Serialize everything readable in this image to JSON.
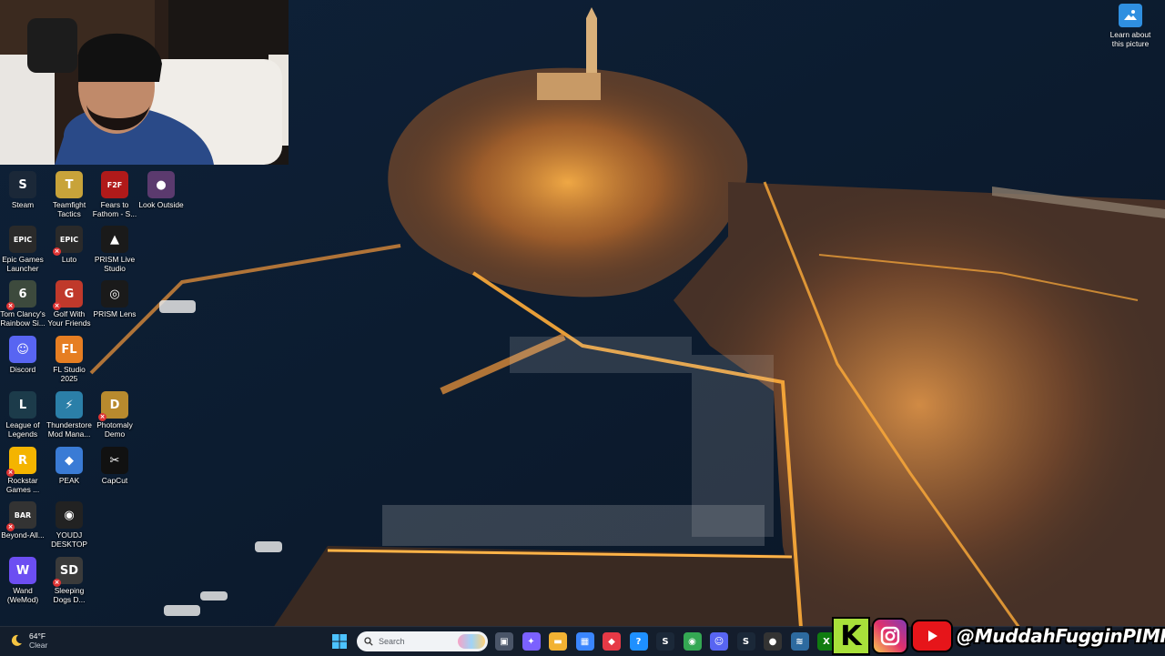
{
  "desktop": {
    "icons": [
      {
        "label": "Steam",
        "color": "#1b2838",
        "glyph": "S",
        "icon": "steam-icon"
      },
      {
        "label": "Teamfight Tactics",
        "color": "#c8a33a",
        "glyph": "T",
        "icon": "teamfight-tactics-icon"
      },
      {
        "label": "Fears to Fathom - S...",
        "color": "#b01a1a",
        "glyph": "F2F",
        "icon": "fears-to-fathom-icon"
      },
      {
        "label": "Look Outside",
        "color": "#5b3a6e",
        "glyph": "●",
        "icon": "look-outside-icon"
      },
      {
        "label": "Epic Games Launcher",
        "color": "#2a2a2a",
        "glyph": "EPIC",
        "icon": "epic-games-icon"
      },
      {
        "label": "Luto",
        "color": "#2a2a2a",
        "glyph": "EPIC",
        "icon": "luto-icon"
      },
      {
        "label": "PRISM Live Studio",
        "color": "#1a1a1a",
        "glyph": "▲",
        "icon": "prism-live-icon"
      },
      {
        "label": "Tom Clancy's Rainbow Si...",
        "color": "#3d4a3d",
        "glyph": "6",
        "icon": "rainbow-six-icon"
      },
      {
        "label": "Golf With Your Friends",
        "color": "#c0392b",
        "glyph": "G",
        "icon": "golf-icon"
      },
      {
        "label": "PRISM Lens",
        "color": "#1a1a1a",
        "glyph": "◎",
        "icon": "prism-lens-icon"
      },
      {
        "label": "Discord",
        "color": "#5865f2",
        "glyph": "☺",
        "icon": "discord-icon"
      },
      {
        "label": "FL Studio 2025",
        "color": "#e67e22",
        "glyph": "FL",
        "icon": "fl-studio-icon"
      },
      {
        "label": "League of Legends",
        "color": "#1c3b4a",
        "glyph": "L",
        "icon": "league-of-legends-icon"
      },
      {
        "label": "Thunderstore Mod Mana...",
        "color": "#2b7fa8",
        "glyph": "⚡",
        "icon": "thunderstore-icon"
      },
      {
        "label": "Photomaly Demo",
        "color": "#b88a2e",
        "glyph": "D",
        "icon": "photomaly-icon"
      },
      {
        "label": "Rockstar Games ...",
        "color": "#f4b400",
        "glyph": "R",
        "icon": "rockstar-icon"
      },
      {
        "label": "PEAK",
        "color": "#3a7bd5",
        "glyph": "◆",
        "icon": "peak-icon"
      },
      {
        "label": "CapCut",
        "color": "#111111",
        "glyph": "✂",
        "icon": "capcut-icon"
      },
      {
        "label": "Beyond-All...",
        "color": "#333333",
        "glyph": "BAR",
        "icon": "beyond-all-reason-icon"
      },
      {
        "label": "YOUDJ DESKTOP",
        "color": "#222222",
        "glyph": "◉",
        "icon": "youdj-icon"
      },
      {
        "label": "Wand (WeMod)",
        "color": "#6c4ef2",
        "glyph": "W",
        "icon": "wemod-icon"
      },
      {
        "label": "Sleeping Dogs D...",
        "color": "#3a3a3a",
        "glyph": "SD",
        "icon": "sleeping-dogs-icon"
      }
    ],
    "learn_about": "Learn about this picture"
  },
  "taskbar": {
    "temperature": "64°F",
    "condition": "Clear",
    "search_placeholder": "Search",
    "apps": [
      {
        "icon": "task-view-icon",
        "color": "#4a5568",
        "glyph": "▣"
      },
      {
        "icon": "copilot-icon",
        "color": "#7b61ff",
        "glyph": "✦"
      },
      {
        "icon": "file-explorer-icon",
        "color": "#f2b233",
        "glyph": "▬"
      },
      {
        "icon": "microsoft-store-icon",
        "color": "#3a86ff",
        "glyph": "▦"
      },
      {
        "icon": "red-diamond-app-icon",
        "color": "#e63946",
        "glyph": "◆"
      },
      {
        "icon": "help-icon",
        "color": "#1e90ff",
        "glyph": "?"
      },
      {
        "icon": "steam-taskbar-icon",
        "color": "#1b2838",
        "glyph": "S"
      },
      {
        "icon": "chrome-icon",
        "color": "#34a853",
        "glyph": "◉"
      },
      {
        "icon": "discord-taskbar-icon",
        "color": "#5865f2",
        "glyph": "☺"
      },
      {
        "icon": "steam-taskbar-icon-2",
        "color": "#1b2838",
        "glyph": "S"
      },
      {
        "icon": "obs-icon",
        "color": "#333333",
        "glyph": "●"
      },
      {
        "icon": "audio-mixer-icon",
        "color": "#2d6a9f",
        "glyph": "≋"
      },
      {
        "icon": "xbox-icon",
        "color": "#107c10",
        "glyph": "X"
      }
    ]
  },
  "social": {
    "kick_glyph": "K",
    "handle": "@MuddahFugginPIMP"
  }
}
